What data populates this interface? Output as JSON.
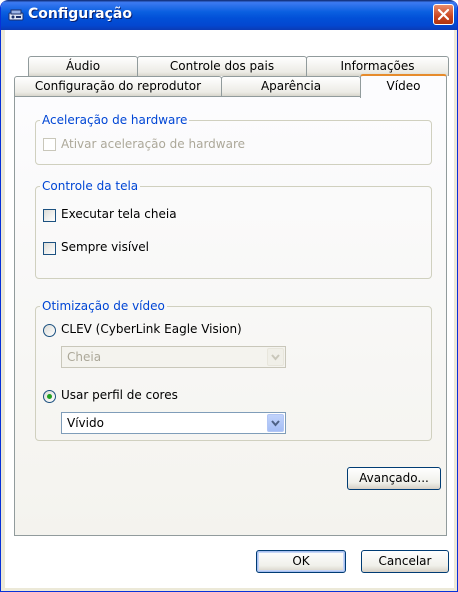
{
  "window": {
    "title": "Configuração",
    "icon": "settings-app-icon",
    "close_icon": "close-icon"
  },
  "tabs": {
    "row_back": [
      "Áudio",
      "Controle dos pais",
      "Informações"
    ],
    "row_front": [
      "Configuração do reprodutor",
      "Aparência",
      "Vídeo"
    ],
    "active": "Vídeo"
  },
  "hardware": {
    "legend": "Aceleração de hardware",
    "checkbox_label": "Ativar aceleração de hardware",
    "checked": false,
    "enabled": false
  },
  "screen": {
    "legend": "Controle da tela",
    "fullscreen_label": "Executar tela cheia",
    "fullscreen_checked": false,
    "always_visible_label": "Sempre visível",
    "always_visible_checked": false
  },
  "video": {
    "legend": "Otimização de vídeo",
    "clev_label": "CLEV (CyberLink Eagle Vision)",
    "clev_selected": false,
    "clev_combo_value": "Cheia",
    "profile_label": "Usar perfil de cores",
    "profile_selected": true,
    "profile_combo_value": "Vívido"
  },
  "buttons": {
    "advanced": "Avançado...",
    "ok": "OK",
    "cancel": "Cancelar"
  },
  "colors": {
    "legend": "#0046d5",
    "active_tab_accent": "#e68b2c",
    "titlebar": "#0250d8",
    "radio_dot": "#21a121"
  }
}
